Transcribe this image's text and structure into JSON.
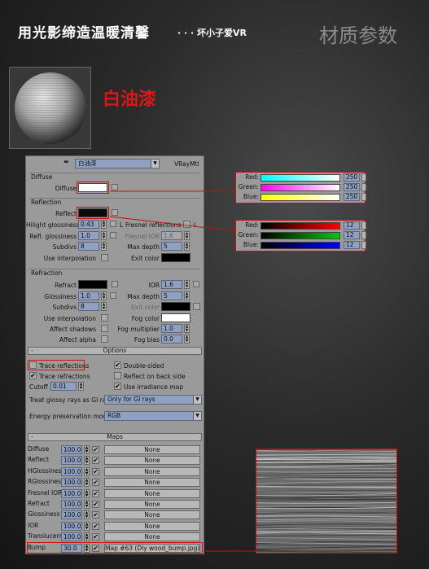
{
  "header": {
    "title": "用光影缔造温暖清馨",
    "subtitle": "· · · 坏小子爱VR",
    "right_title": "材质参数"
  },
  "material_label": "白油漆",
  "panel": {
    "material_name": "白油漆",
    "material_type": "VRayMtl",
    "diffuse": {
      "section": "Diffuse",
      "label": "Diffuse",
      "color": "#ffffff"
    },
    "reflection": {
      "section": "Reflection",
      "reflect_label": "Reflect",
      "reflect_color": "#0c0c0c",
      "hilight_glossiness_label": "Hilight glossiness",
      "hilight_glossiness": "0.43",
      "l_label": "L",
      "fresnel_label": "Fresnel reflections",
      "refl_glossiness_label": "Refl. glossiness",
      "refl_glossiness": "1.0",
      "fresnel_ior_label": "Fresnel IOR",
      "fresnel_ior": "1.6",
      "subdivs_label": "Subdivs",
      "subdivs": "8",
      "max_depth_label": "Max depth",
      "max_depth": "5",
      "use_interp_label": "Use interpolation",
      "exit_color_label": "Exit color"
    },
    "refraction": {
      "section": "Refraction",
      "refract_label": "Refract",
      "ior_label": "IOR",
      "ior": "1.6",
      "glossiness_label": "Glossiness",
      "glossiness": "1.0",
      "max_depth_label": "Max depth",
      "max_depth": "5",
      "subdivs_label": "Subdivs",
      "subdivs": "8",
      "exit_color_label": "Exit color",
      "use_interp_label": "Use interpolation",
      "fog_color_label": "Fog color",
      "affect_shadows_label": "Affect shadows",
      "fog_multiplier_label": "Fog multiplier",
      "fog_multiplier": "1.0",
      "affect_alpha_label": "Affect alpha",
      "fog_bias_label": "Fog bias",
      "fog_bias": "0.0"
    },
    "options": {
      "rollout_label": "Options",
      "rollout_sign": "-",
      "trace_reflections": "Trace reflections",
      "double_sided": "Double-sided",
      "trace_refractions": "Trace refractions",
      "reflect_back_side": "Reflect on back side",
      "cutoff_label": "Cutoff",
      "cutoff": "0.01",
      "use_irradiance_map": "Use irradiance map",
      "glossy_rays_label": "Treat glossy rays as GI rays:",
      "glossy_rays_value": "Only for GI rays",
      "energy_label": "Energy preservation mode:",
      "energy_value": "RGB",
      "check_mark": "✔"
    },
    "maps": {
      "rollout_label": "Maps",
      "rollout_sign": "-",
      "rows": [
        {
          "name": "Diffuse",
          "value": "100.0",
          "map": "None"
        },
        {
          "name": "Reflect",
          "value": "100.0",
          "map": "None"
        },
        {
          "name": "HGlossiness",
          "value": "100.0",
          "map": "None"
        },
        {
          "name": "RGlossiness",
          "value": "100.0",
          "map": "None"
        },
        {
          "name": "Fresnel IOR",
          "value": "100.0",
          "map": "None"
        },
        {
          "name": "Refract",
          "value": "100.0",
          "map": "None"
        },
        {
          "name": "Glossiness",
          "value": "100.0",
          "map": "None"
        },
        {
          "name": "IOR",
          "value": "100.0",
          "map": "None"
        },
        {
          "name": "Translucent",
          "value": "100.0",
          "map": "None"
        },
        {
          "name": "Bump",
          "value": "30.0",
          "map": "Map #63 (Diy wood_bump.jpg)"
        }
      ]
    }
  },
  "diffuse_picker": {
    "red_label": "Red:",
    "red": "250",
    "green_label": "Green:",
    "green": "250",
    "blue_label": "Blue:",
    "blue": "250"
  },
  "reflect_picker": {
    "red_label": "Red:",
    "red": "12",
    "green_label": "Green:",
    "green": "12",
    "blue_label": "Blue:",
    "blue": "12"
  }
}
